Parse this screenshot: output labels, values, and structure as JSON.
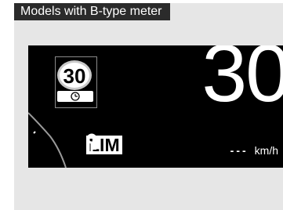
{
  "label": "Models with B-type meter",
  "meter": {
    "sign_value": "30",
    "speed": "30",
    "lim_text": "LIM",
    "set_speed_placeholder": "---",
    "unit": "km/h"
  }
}
